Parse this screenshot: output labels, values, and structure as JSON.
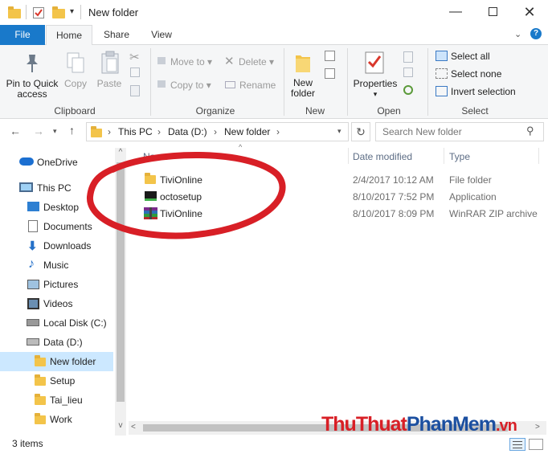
{
  "window": {
    "title": "New folder"
  },
  "tabs": [
    "File",
    "Home",
    "Share",
    "View"
  ],
  "ribbon": {
    "clipboard": {
      "pin_to_quick_access": [
        "Pin to Quick",
        "access"
      ],
      "copy": "Copy",
      "paste": "Paste",
      "label": "Clipboard"
    },
    "organize": {
      "move_to": "Move to",
      "copy_to": "Copy to",
      "delete": "Delete",
      "rename": "Rename",
      "label": "Organize"
    },
    "new": {
      "new_folder": [
        "New",
        "folder"
      ],
      "label": "New"
    },
    "open": {
      "properties": "Properties",
      "label": "Open"
    },
    "select": {
      "select_all": "Select all",
      "select_none": "Select none",
      "invert_selection": "Invert selection",
      "label": "Select"
    }
  },
  "address": {
    "crumbs": [
      "This PC",
      "Data (D:)",
      "New folder"
    ]
  },
  "search": {
    "placeholder": "Search New folder"
  },
  "nav": [
    "OneDrive",
    "This PC",
    "Desktop",
    "Documents",
    "Downloads",
    "Music",
    "Pictures",
    "Videos",
    "Local Disk (C:)",
    "Data (D:)",
    "New folder",
    "Setup",
    "Tai_lieu",
    "Work"
  ],
  "columns": {
    "name": "Name",
    "date": "Date modified",
    "type": "Type"
  },
  "files": [
    {
      "name": "TiviOnline",
      "date": "2/4/2017 10:12 AM",
      "type": "File folder",
      "icon": "folder-icon"
    },
    {
      "name": "octosetup",
      "date": "8/10/2017 7:52 PM",
      "type": "Application",
      "icon": "application-icon"
    },
    {
      "name": "TiviOnline",
      "date": "8/10/2017 8:09 PM",
      "type": "WinRAR ZIP archive",
      "icon": "winrar-archive-icon"
    }
  ],
  "status": {
    "count": "3 items"
  },
  "watermark": {
    "part1": "ThuThuat",
    "part2": "PhanMem",
    "part3": ".vn"
  }
}
